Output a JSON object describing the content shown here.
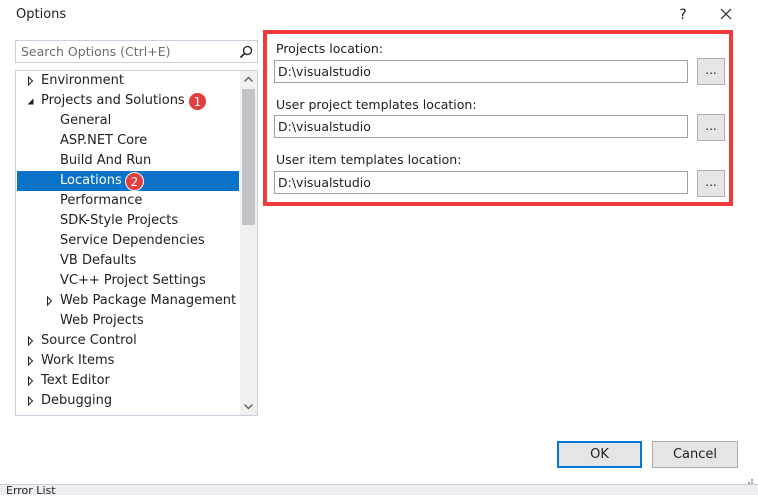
{
  "window": {
    "title": "Options",
    "help_label": "?"
  },
  "search": {
    "placeholder": "Search Options (Ctrl+E)",
    "icon": "search-icon"
  },
  "tree": {
    "items": [
      {
        "label": "Environment",
        "expander": "collapsed",
        "level": 0
      },
      {
        "label": "Projects and Solutions",
        "expander": "expanded",
        "level": 0,
        "badge": "1"
      },
      {
        "label": "General",
        "level": 1
      },
      {
        "label": "ASP.NET Core",
        "level": 1
      },
      {
        "label": "Build And Run",
        "level": 1
      },
      {
        "label": "Locations",
        "level": 1,
        "selected": true,
        "badge": "2"
      },
      {
        "label": "Performance",
        "level": 1
      },
      {
        "label": "SDK-Style Projects",
        "level": 1
      },
      {
        "label": "Service Dependencies",
        "level": 1
      },
      {
        "label": "VB Defaults",
        "level": 1
      },
      {
        "label": "VC++ Project Settings",
        "level": 1
      },
      {
        "label": "Web Package Management",
        "expander": "collapsed",
        "level": 1
      },
      {
        "label": "Web Projects",
        "level": 1
      },
      {
        "label": "Source Control",
        "expander": "collapsed",
        "level": 0
      },
      {
        "label": "Work Items",
        "expander": "collapsed",
        "level": 0
      },
      {
        "label": "Text Editor",
        "expander": "collapsed",
        "level": 0
      },
      {
        "label": "Debugging",
        "expander": "collapsed",
        "level": 0
      }
    ]
  },
  "locations": {
    "projects_label": "Projects location:",
    "projects_value": "D:\\visualstudio",
    "user_project_templates_label": "User project templates location:",
    "user_project_templates_value": "D:\\visualstudio",
    "user_item_templates_label": "User item templates location:",
    "user_item_templates_value": "D:\\visualstudio",
    "browse_label": "..."
  },
  "buttons": {
    "ok": "OK",
    "cancel": "Cancel"
  },
  "background": {
    "error_list_label": "Error List"
  },
  "colors": {
    "selection": "#0a73c8",
    "highlight_box": "#f23a3a",
    "badge": "#e33e3e",
    "default_button_border": "#0078d7"
  }
}
